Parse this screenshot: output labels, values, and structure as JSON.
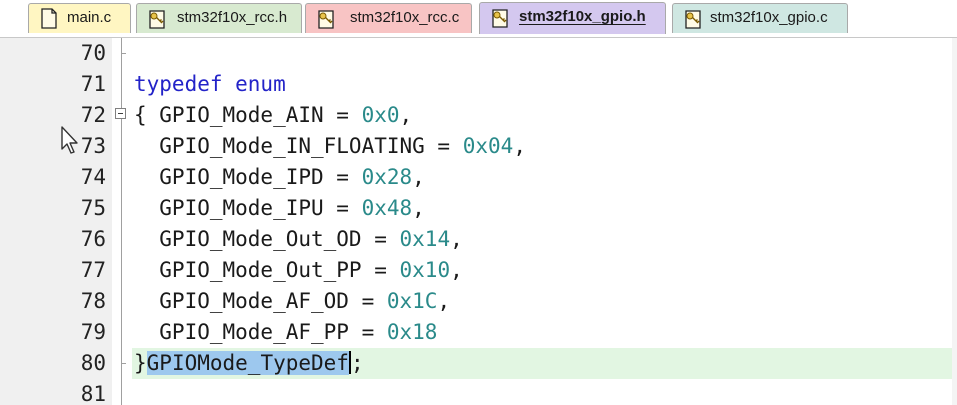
{
  "tabs": [
    {
      "label": "main.c",
      "color": "#fff6c2",
      "icon": "file-icon",
      "active": false
    },
    {
      "label": "stm32f10x_rcc.h",
      "color": "#d8ead0",
      "icon": "header-file-key-icon",
      "active": false
    },
    {
      "label": "stm32f10x_rcc.c",
      "color": "#f8c4c4",
      "icon": "source-file-key-icon",
      "active": false
    },
    {
      "label": "stm32f10x_gpio.h",
      "color": "#d4c8ef",
      "icon": "header-file-key-icon",
      "active": true
    },
    {
      "label": "stm32f10x_gpio.c",
      "color": "#cfe7e2",
      "icon": "source-file-key-icon",
      "active": false
    }
  ],
  "editor": {
    "lines": [
      {
        "num": "70",
        "tokens": [
          {
            "t": "",
            "c": ""
          }
        ]
      },
      {
        "num": "71",
        "tokens": [
          {
            "t": "typedef enum",
            "c": "kw"
          }
        ]
      },
      {
        "num": "72",
        "tokens": [
          {
            "t": "{ GPIO_Mode_AIN = ",
            "c": "ident"
          },
          {
            "t": "0x0",
            "c": "num"
          },
          {
            "t": ",",
            "c": "ident"
          }
        ]
      },
      {
        "num": "73",
        "tokens": [
          {
            "t": "  GPIO_Mode_IN_FLOATING = ",
            "c": "ident"
          },
          {
            "t": "0x04",
            "c": "num"
          },
          {
            "t": ",",
            "c": "ident"
          }
        ]
      },
      {
        "num": "74",
        "tokens": [
          {
            "t": "  GPIO_Mode_IPD = ",
            "c": "ident"
          },
          {
            "t": "0x28",
            "c": "num"
          },
          {
            "t": ",",
            "c": "ident"
          }
        ]
      },
      {
        "num": "75",
        "tokens": [
          {
            "t": "  GPIO_Mode_IPU = ",
            "c": "ident"
          },
          {
            "t": "0x48",
            "c": "num"
          },
          {
            "t": ",",
            "c": "ident"
          }
        ]
      },
      {
        "num": "76",
        "tokens": [
          {
            "t": "  GPIO_Mode_Out_OD = ",
            "c": "ident"
          },
          {
            "t": "0x14",
            "c": "num"
          },
          {
            "t": ",",
            "c": "ident"
          }
        ]
      },
      {
        "num": "77",
        "tokens": [
          {
            "t": "  GPIO_Mode_Out_PP = ",
            "c": "ident"
          },
          {
            "t": "0x10",
            "c": "num"
          },
          {
            "t": ",",
            "c": "ident"
          }
        ]
      },
      {
        "num": "78",
        "tokens": [
          {
            "t": "  GPIO_Mode_AF_OD = ",
            "c": "ident"
          },
          {
            "t": "0x1C",
            "c": "num"
          },
          {
            "t": ",",
            "c": "ident"
          }
        ]
      },
      {
        "num": "79",
        "tokens": [
          {
            "t": "  GPIO_Mode_AF_PP = ",
            "c": "ident"
          },
          {
            "t": "0x18",
            "c": "num"
          }
        ]
      },
      {
        "num": "80",
        "tokens": [
          {
            "t": "}",
            "c": "ident"
          },
          {
            "t": "GPIOMode_TypeDef",
            "c": "sel"
          },
          {
            "t": "",
            "c": "caret"
          },
          {
            "t": ";",
            "c": "ident"
          }
        ],
        "highlight": true
      },
      {
        "num": "81",
        "tokens": [
          {
            "t": "",
            "c": ""
          }
        ]
      }
    ],
    "colors": {
      "keyword": "#2323c8",
      "number": "#2a8a8a",
      "selection": "#9dc8ee",
      "current_line": "#e2f6e2",
      "gutter": "#f0f0f0"
    }
  }
}
